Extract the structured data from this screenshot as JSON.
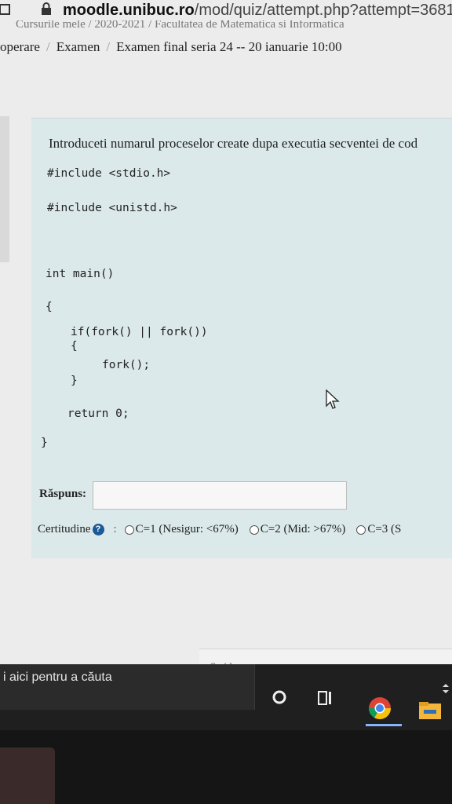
{
  "browser": {
    "url_host": "moodle.unibuc.ro",
    "url_path": "/mod/quiz/attempt.php?attempt=3681"
  },
  "top_crumbs_partial": "Cursurile mele  /  2020-2021  /  Facultatea de Matematica si Informatica",
  "breadcrumb": {
    "items": [
      "operare",
      "Examen",
      "Examen final seria 24 -- 20 ianuarie 10:00"
    ],
    "separator": "/"
  },
  "question": {
    "prompt": "Introduceti numarul proceselor create dupa executia secventei de cod",
    "code_lines": [
      "#include <stdio.h>",
      "#include <unistd.h>",
      "int main()",
      "{",
      "if(fork() || fork())",
      "{",
      "fork();",
      "}",
      "return 0;",
      "}"
    ],
    "answer_label": "Răspuns:",
    "answer_value": "",
    "certitude_label": "Certitudine",
    "help_icon": "question-circle-icon",
    "options": [
      "C=1 (Nesigur: <67%)",
      "C=2 (Mid: >67%)",
      "C=3 (S"
    ]
  },
  "footer": {
    "jump_label": "Sari la..."
  },
  "taskbar": {
    "search_placeholder": "i aici pentru a căuta",
    "icons": [
      "cortana-circle-icon",
      "task-view-icon",
      "chrome-icon",
      "file-explorer-icon"
    ]
  },
  "colors": {
    "question_bg": "#dbe9ea",
    "help_icon": "#1a5a9a",
    "taskbar": "#1f1f1f"
  }
}
